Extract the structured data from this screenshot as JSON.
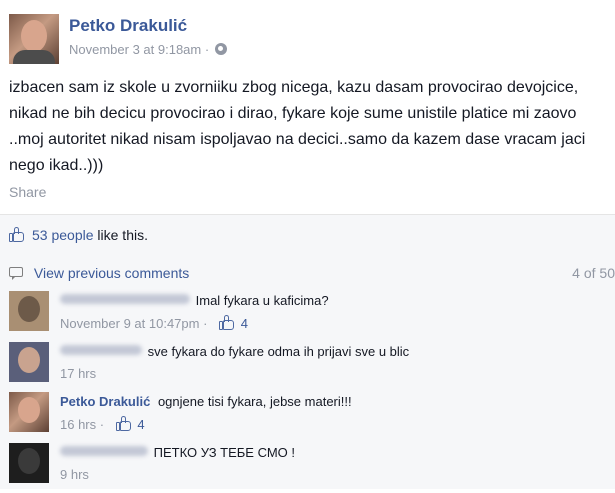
{
  "post": {
    "author": "Petko Drakulić",
    "timestamp": "November 3 at 9:18am",
    "separator": "·",
    "privacy_icon": "globe-icon",
    "text": "izbacen sam iz skole u zvorniiku zbog nicega, kazu dasam provocirao devojcice, nikad ne bih decicu provocirao i dirao, fykare koje sume unistile platice mi zaovo ..moj autoritet nikad nisam ispoljavao na decici..samo da kazem dase vracam jaci nego ikad..)))",
    "share_label": "Share"
  },
  "likes": {
    "count_text": "53 people",
    "suffix": "like this."
  },
  "comments": {
    "view_previous": "View previous comments",
    "counter": "4 of 50",
    "items": [
      {
        "name": "",
        "text": "Imal fykara u kaficima?",
        "time": "November 9 at 10:47pm",
        "likes": "4"
      },
      {
        "name": "",
        "text": "sve fykara do fykare odma ih prijavi sve u blic",
        "time": "17 hrs",
        "likes": ""
      },
      {
        "name": "Petko Drakulić",
        "text": "ognjene tisi fykara, jebse materi!!!",
        "time": "16 hrs",
        "likes": "4"
      },
      {
        "name": "",
        "text": "ПЕТКО УЗ ТЕБЕ СМО !",
        "time": "9 hrs",
        "likes": ""
      }
    ]
  },
  "colors": {
    "link": "#3b5998",
    "meta": "#9197a3",
    "panel": "#f6f7f9"
  }
}
